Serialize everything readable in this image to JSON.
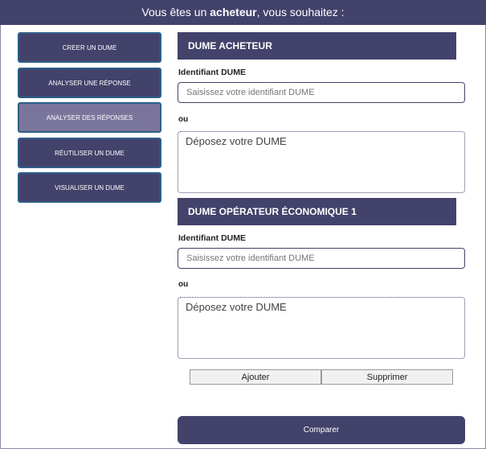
{
  "header": {
    "prefix": "Vous êtes un ",
    "role": "acheteur",
    "suffix": ", vous souhaitez :"
  },
  "nav": {
    "items": [
      {
        "label": "CREER UN DUME"
      },
      {
        "label": "ANALYSER UNE RÉPONSE"
      },
      {
        "label": "ANALYSER DES RÉPONSES",
        "active": true
      },
      {
        "label": "RÉUTILISER UN DUME"
      },
      {
        "label": "VISUALISER UN DUME"
      }
    ]
  },
  "acheteur": {
    "title": "DUME ACHETEUR",
    "id_label": "Identifiant DUME",
    "id_placeholder": "Saisissez votre identifiant DUME",
    "ou": "ou",
    "drop_label": "Déposez votre DUME"
  },
  "operateur": {
    "title": "DUME OPÉRATEUR ÉCONOMIQUE 1",
    "id_label": "Identifiant DUME",
    "id_placeholder": "Saisissez votre identifiant DUME",
    "ou": "ou",
    "drop_label": "Déposez votre DUME"
  },
  "actions": {
    "add_label": "Ajouter",
    "remove_label": "Supprimer",
    "compare_label": "Comparer"
  },
  "colors": {
    "primary": "#43426b",
    "active": "#7a759b",
    "nav_border": "#2e5f8a"
  }
}
